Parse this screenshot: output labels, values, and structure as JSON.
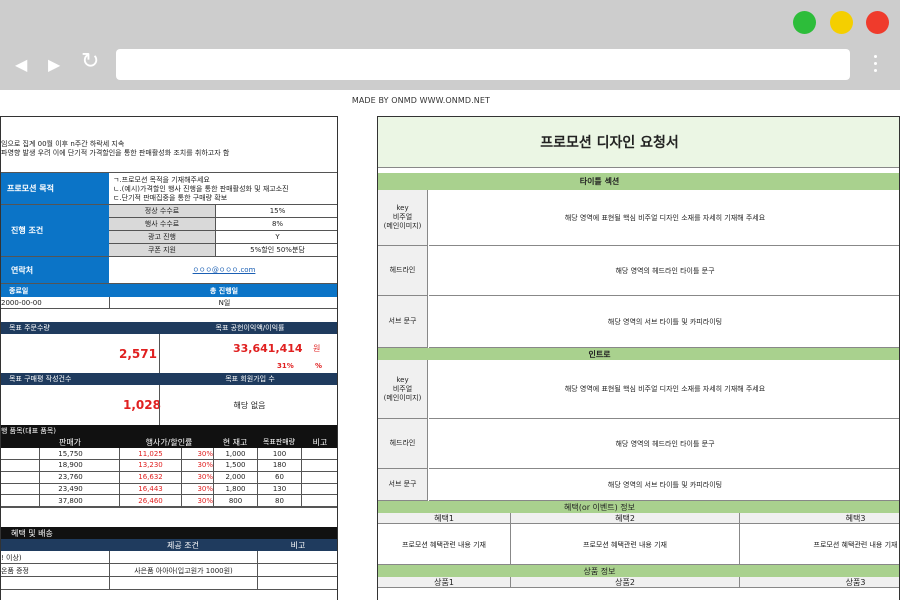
{
  "browser": {
    "colors": {
      "green": "#2dbd3a",
      "yellow": "#f4cf00",
      "red": "#ef3b2c",
      "chrome": "#cdcdcd"
    },
    "back_icon": "◀",
    "forward_icon": "▶",
    "reload_icon": "↻"
  },
  "credit": "MADE BY ONMD WWW.ONMD.NET",
  "left": {
    "intro_1": "임으로 집계 00월 이후 n주간 하락세 지속",
    "intro_2": "파영향 발생 우려 이에 단기적 가격할인을 통한 판매활성화 조치를 취하고자 함",
    "purpose_label": "프로모션 목적",
    "purpose_lines": [
      "ㄱ.프로모션 목적을 기재해주세요",
      "ㄴ.(예시)가격할인 행사 진행을 통한 판매활성화 및 재고소진",
      "ㄷ.단기적 판매집중을 통한 구매량 확보"
    ],
    "condition_label": "진행 조건",
    "conditions": [
      {
        "label": "정상 수수료",
        "value": "15%"
      },
      {
        "label": "행사 수수료",
        "value": "8%"
      },
      {
        "label": "광고 진행",
        "value": "Y"
      },
      {
        "label": "쿠폰 지원",
        "value": "5%할인 50%분담"
      }
    ],
    "contact_label": "연락처",
    "contact_value": "ㅇㅇㅇ@ㅇㅇㅇ.com",
    "end_label": "종료일",
    "total_label": "총 진행일",
    "end_value": "2000-00-00",
    "total_value": "N일",
    "order_label": "목표 주문수량",
    "order_value": "2,571",
    "profit_label": "목표 공헌이익액/이익률",
    "profit_value": "33,641,414",
    "profit_unit": "원",
    "profit_rate": "31%",
    "profit_rate_unit": "%",
    "review_label": "목표 구매평 작성건수",
    "review_value": "1,028",
    "member_label": "목표 회원가입 수",
    "member_value": "해당 없음",
    "items_title": "행 품목(대표 품목)",
    "items_headers": [
      "판매가",
      "행사가/할인률",
      "",
      "현 재고",
      "목표판매량",
      "비고"
    ],
    "items": [
      [
        "15,750",
        "11,025",
        "30%",
        "1,000",
        "100",
        ""
      ],
      [
        "18,900",
        "13,230",
        "30%",
        "1,500",
        "180",
        ""
      ],
      [
        "23,760",
        "16,632",
        "30%",
        "2,000",
        "60",
        ""
      ],
      [
        "23,490",
        "16,443",
        "30%",
        "1,800",
        "130",
        ""
      ],
      [
        "37,800",
        "26,460",
        "30%",
        "800",
        "80",
        ""
      ]
    ],
    "benefit_title": "혜택 및 배송",
    "benefit_headers": [
      "",
      "제공 조건",
      "비고"
    ],
    "benefits": [
      [
        "! 이상)",
        "",
        ""
      ],
      [
        "온품 증정",
        "사은품 아아아(입고원가 1000원)",
        ""
      ],
      [
        "",
        "",
        ""
      ]
    ]
  },
  "right": {
    "title": "프로모션 디자인 요청서",
    "section_title": "타이틀 섹션",
    "rows_title": [
      {
        "label": "key\n비주얼\n(메인이미지)",
        "value": "해당 영역에 표현될 핵심 비주얼 디자인 소재를 자세히 기재해 주세요"
      },
      {
        "label": "헤드라인",
        "value": "해당 영역의 헤드라인 타이틀 문구"
      },
      {
        "label": "서브 문구",
        "value": "해당 영역의 서브 타이틀 및 카피라이팅"
      }
    ],
    "section_intro": "인트로",
    "rows_intro": [
      {
        "label": "key\n비주얼\n(메인이미지)",
        "value": "해당 영역에 표현될 핵심 비주얼 디자인 소재를 자세히 기재해 주세요"
      },
      {
        "label": "헤드라인",
        "value": "해당 영역의 헤드라인 타이틀 문구"
      },
      {
        "label": "서브 문구",
        "value": "해당 영역의 서브 타이틀 및 카피라이팅"
      }
    ],
    "section_benefit": "혜택(or 이벤트) 정보",
    "benefit_cols": [
      "혜택1",
      "혜택2",
      "혜택3"
    ],
    "benefit_vals": [
      "프로모션 혜택관련 내용 기재",
      "프로모션 혜택관련 내용 기재",
      "프로모션 혜택관련 내용 기재"
    ],
    "section_product": "상품 정보",
    "product_cols": [
      "상품1",
      "상품2",
      "상품3"
    ]
  }
}
